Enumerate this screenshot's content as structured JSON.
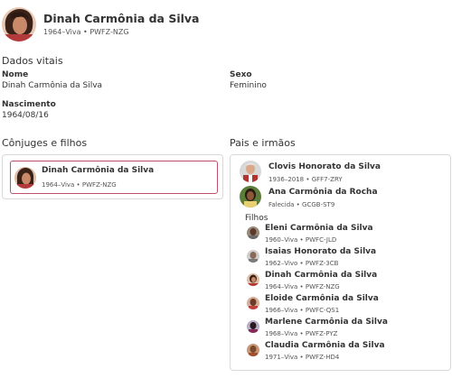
{
  "profile": {
    "name": "Dinah Carmônia da Silva",
    "meta": "1964–Viva • PWFZ-NZG"
  },
  "vitals": {
    "title": "Dados vitais",
    "name_label": "Nome",
    "name_value": "Dinah Carmônia da Silva",
    "sex_label": "Sexo",
    "sex_value": "Feminino",
    "birth_label": "Nascimento",
    "birth_value": "1964/08/16"
  },
  "spouses": {
    "title": "Cônjuges e filhos",
    "person": {
      "name": "Dinah Carmônia da Silva",
      "meta": "1964–Viva • PWFZ-NZG"
    }
  },
  "parents": {
    "title": "Pais e irmãos",
    "father": {
      "name": "Clovis Honorato da Silva",
      "meta": "1936–2018 • GFF7-ZRY"
    },
    "mother": {
      "name": "Ana Carmônia da Rocha",
      "meta": "Falecida • GCGB-ST9"
    },
    "children_label": "Filhos",
    "children": [
      {
        "name": "Eleni Carmônia da Silva",
        "meta": "1960–Viva • PWFC-JLD"
      },
      {
        "name": "Isaias Honorato da Silva",
        "meta": "1962–Vivo • PWFZ-3CB"
      },
      {
        "name": "Dinah Carmônia da Silva",
        "meta": "1964–Viva • PWFZ-NZG"
      },
      {
        "name": "Eloide Carmônia da Silva",
        "meta": "1966–Viva • PWFC-QS1"
      },
      {
        "name": "Marlene Carmônia da Silva",
        "meta": "1968–Viva • PWFZ-PYZ"
      },
      {
        "name": "Claudia Carmônia da Silva",
        "meta": "1971–Viva • PWFZ-HD4"
      }
    ]
  },
  "colors": {
    "selected_border": "#c0506a",
    "card_border": "#d9d9d9",
    "text": "#333333"
  }
}
